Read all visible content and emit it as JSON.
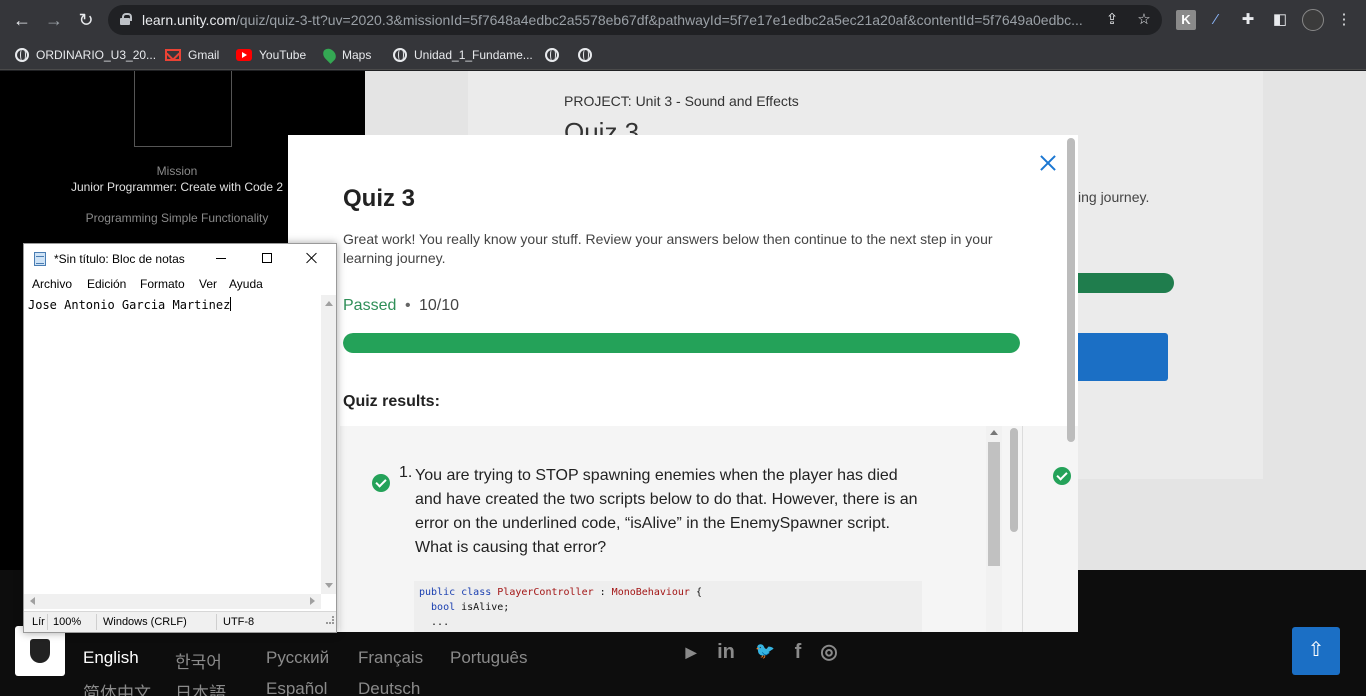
{
  "browser": {
    "url_host": "learn.unity.com",
    "url_path": "/quiz/quiz-3-tt?uv=2020.3&missionId=5f7648a4edbc2a5578eb67df&pathwayId=5f7e17e1edbc2a5ec21a20af&contentId=5f7649a0edbc...",
    "ext_k_label": "K",
    "bookmarks": [
      {
        "label": "ORDINARIO_U3_20...",
        "icon": "globe-icon"
      },
      {
        "label": "Gmail",
        "icon": "gmail-icon"
      },
      {
        "label": "YouTube",
        "icon": "youtube-icon"
      },
      {
        "label": "Maps",
        "icon": "maps-icon"
      },
      {
        "label": "Unidad_1_Fundame...",
        "icon": "globe-icon"
      }
    ]
  },
  "sidebar": {
    "mission_label": "Mission",
    "mission_title": "Junior Programmer: Create with Code 2",
    "mission_subtitle": "Programming Simple Functionality"
  },
  "background": {
    "project_label": "PROJECT:  Unit 3 - Sound and Effects",
    "title": "Quiz 3",
    "journey_text": "ing journey."
  },
  "modal": {
    "title": "Quiz 3",
    "description": "Great work! You really know your stuff. Review your answers below then continue to the next step in your learning journey.",
    "status": "Passed",
    "separator": "•",
    "score": "10/10",
    "progress_percent": 100,
    "results_heading": "Quiz results:",
    "question_number": "1.",
    "question_text": "You are trying to STOP spawning enemies when the player has died and have created the two scripts below to do that. However, there is an error on the underlined code, “isAlive” in the EnemySpawner script. What is causing that error?",
    "code_line_1_kw": "public class ",
    "code_line_1_cls": "PlayerController",
    "code_line_1_sep": " : ",
    "code_line_1_base": "MonoBehaviour",
    "code_line_1_end": " {",
    "code_line_2_kw": "  bool",
    "code_line_2_rest": " isAlive;",
    "code_line_3": "  ..."
  },
  "footer": {
    "languages": [
      "English",
      "한국어",
      "Русский",
      "Français",
      "Português",
      "简体中文",
      "日本語",
      "Español",
      "Deutsch"
    ],
    "social": [
      "youtube-icon",
      "linkedin-icon",
      "twitter-icon",
      "facebook-icon",
      "instagram-icon"
    ],
    "social_glyphs": [
      "▶",
      "in",
      "🐦",
      "f",
      "◎"
    ]
  },
  "notepad": {
    "title": "*Sin título: Bloc de notas",
    "menu": [
      "Archivo",
      "Edición",
      "Formato",
      "Ver",
      "Ayuda"
    ],
    "content": "Jose Antonio Garcia Martinez",
    "status_line": "Lír",
    "status_zoom": "100%",
    "status_eol": "Windows (CRLF)",
    "status_encoding": "UTF-8"
  },
  "colors": {
    "accent_green": "#24a259",
    "accent_blue": "#1b6fc5",
    "passed_text": "#2f8f58"
  }
}
